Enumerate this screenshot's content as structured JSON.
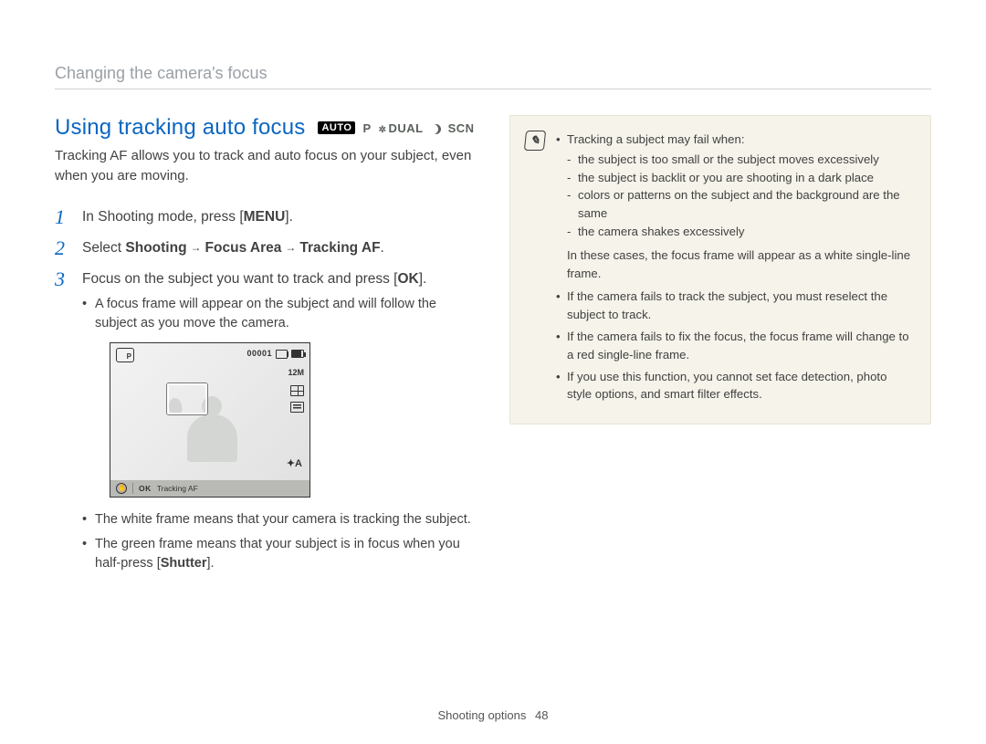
{
  "breadcrumb": "Changing the camera's focus",
  "heading": "Using tracking auto focus",
  "mode_badges": {
    "auto": "AUTO",
    "p": "P",
    "dual": "DUAL",
    "scn": "SCN"
  },
  "intro": "Tracking AF allows you to track and auto focus on your subject, even when you are moving.",
  "steps": {
    "s1": {
      "num": "1",
      "pre": "In Shooting mode, press [",
      "btn": "MENU",
      "post": "]."
    },
    "s2": {
      "num": "2",
      "pre": "Select ",
      "w1": "Shooting",
      "w2": "Focus Area",
      "w3": "Tracking AF",
      "post": "."
    },
    "s3": {
      "num": "3",
      "pre": "Focus on the subject you want to track and press [",
      "btn": "OK",
      "post": "].",
      "bullets": {
        "b1": "A focus frame will appear on the subject and will follow the subject as you move the camera.",
        "b2_pre": "The white frame means that your camera is tracking the subject.",
        "b3_pre": "The green frame means that your subject is in focus when you half-press [",
        "b3_btn": "Shutter",
        "b3_post": "]."
      }
    }
  },
  "camera_screen": {
    "counter": "00001",
    "res": "12M",
    "flash": "✦A",
    "ok": "OK",
    "label": "Tracking AF"
  },
  "note": {
    "lead": "Tracking a subject may fail when:",
    "reasons": {
      "r1": "the subject is too small or the subject moves excessively",
      "r2": "the subject is backlit or you are shooting in a dark place",
      "r3": "colors or patterns on the subject and the background are the same",
      "r4": "the camera shakes excessively"
    },
    "followup": "In these cases, the focus frame will appear as a white single-line frame.",
    "extra": {
      "e1": "If the camera fails to track the subject, you must reselect the subject to track.",
      "e2": "If the camera fails to fix the focus, the focus frame will change to a red single-line frame.",
      "e3": "If you use this function, you cannot set face detection, photo style options, and smart filter effects."
    }
  },
  "footer": {
    "section": "Shooting options",
    "page": "48"
  }
}
